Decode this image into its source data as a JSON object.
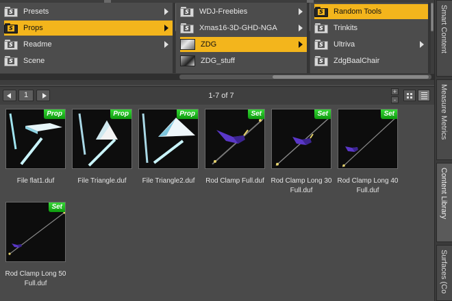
{
  "colors": {
    "selected": "#f3b51c",
    "badge": "#1fb81f",
    "panel": "#4a4a4a"
  },
  "columns": [
    {
      "items": [
        {
          "label": "Presets",
          "icon": "folder-s-icon",
          "arrow": true,
          "selected": false
        },
        {
          "label": "Props",
          "icon": "folder-s-icon",
          "arrow": true,
          "selected": true
        },
        {
          "label": "Readme",
          "icon": "folder-s-icon",
          "arrow": true,
          "selected": false
        },
        {
          "label": "Scene",
          "icon": "folder-s-icon",
          "arrow": false,
          "selected": false
        }
      ]
    },
    {
      "items": [
        {
          "label": "WDJ-Freebies",
          "icon": "folder-s-icon",
          "arrow": true,
          "selected": false
        },
        {
          "label": "Xmas16-3D-GHD-NGA",
          "icon": "folder-s-icon",
          "arrow": true,
          "selected": false
        },
        {
          "label": "ZDG",
          "icon": "folder-thumbnail-icon",
          "arrow": true,
          "selected": true
        },
        {
          "label": "ZDG_stuff",
          "icon": "folder-thumbnail-icon",
          "arrow": false,
          "selected": false
        }
      ]
    },
    {
      "items": [
        {
          "label": "Random Tools",
          "icon": "folder-s-icon",
          "arrow": false,
          "selected": true
        },
        {
          "label": "Trinkits",
          "icon": "folder-s-icon",
          "arrow": false,
          "selected": false
        },
        {
          "label": "Ultriva",
          "icon": "folder-s-icon",
          "arrow": true,
          "selected": false
        },
        {
          "label": "ZdgBaalChair",
          "icon": "folder-s-icon",
          "arrow": false,
          "selected": false
        }
      ]
    }
  ],
  "toolbar": {
    "page": "1",
    "range": "1-7 of 7",
    "zoom_in": "+",
    "zoom_out": "-"
  },
  "files": [
    {
      "name": "File flat1.duf",
      "badge": "Prop",
      "art": "flat"
    },
    {
      "name": "File Triangle.duf",
      "badge": "Prop",
      "art": "triangle"
    },
    {
      "name": "File Triangle2.duf",
      "badge": "Prop",
      "art": "triangle2"
    },
    {
      "name": "Rod Clamp Full.duf",
      "badge": "Set",
      "art": "clamp"
    },
    {
      "name": "Rod Clamp Long 30 Full.duf",
      "badge": "Set",
      "art": "long30"
    },
    {
      "name": "Rod Clamp Long 40 Full.duf",
      "badge": "Set",
      "art": "long40"
    },
    {
      "name": "Rod Clamp Long 50 Full.duf",
      "badge": "Set",
      "art": "long50"
    }
  ],
  "side_tabs": [
    {
      "label": "Smart Content",
      "active": false
    },
    {
      "label": "Measure Metrics",
      "active": false
    },
    {
      "label": "Content Library",
      "active": true
    },
    {
      "label": "Surfaces (Co",
      "active": false
    }
  ]
}
